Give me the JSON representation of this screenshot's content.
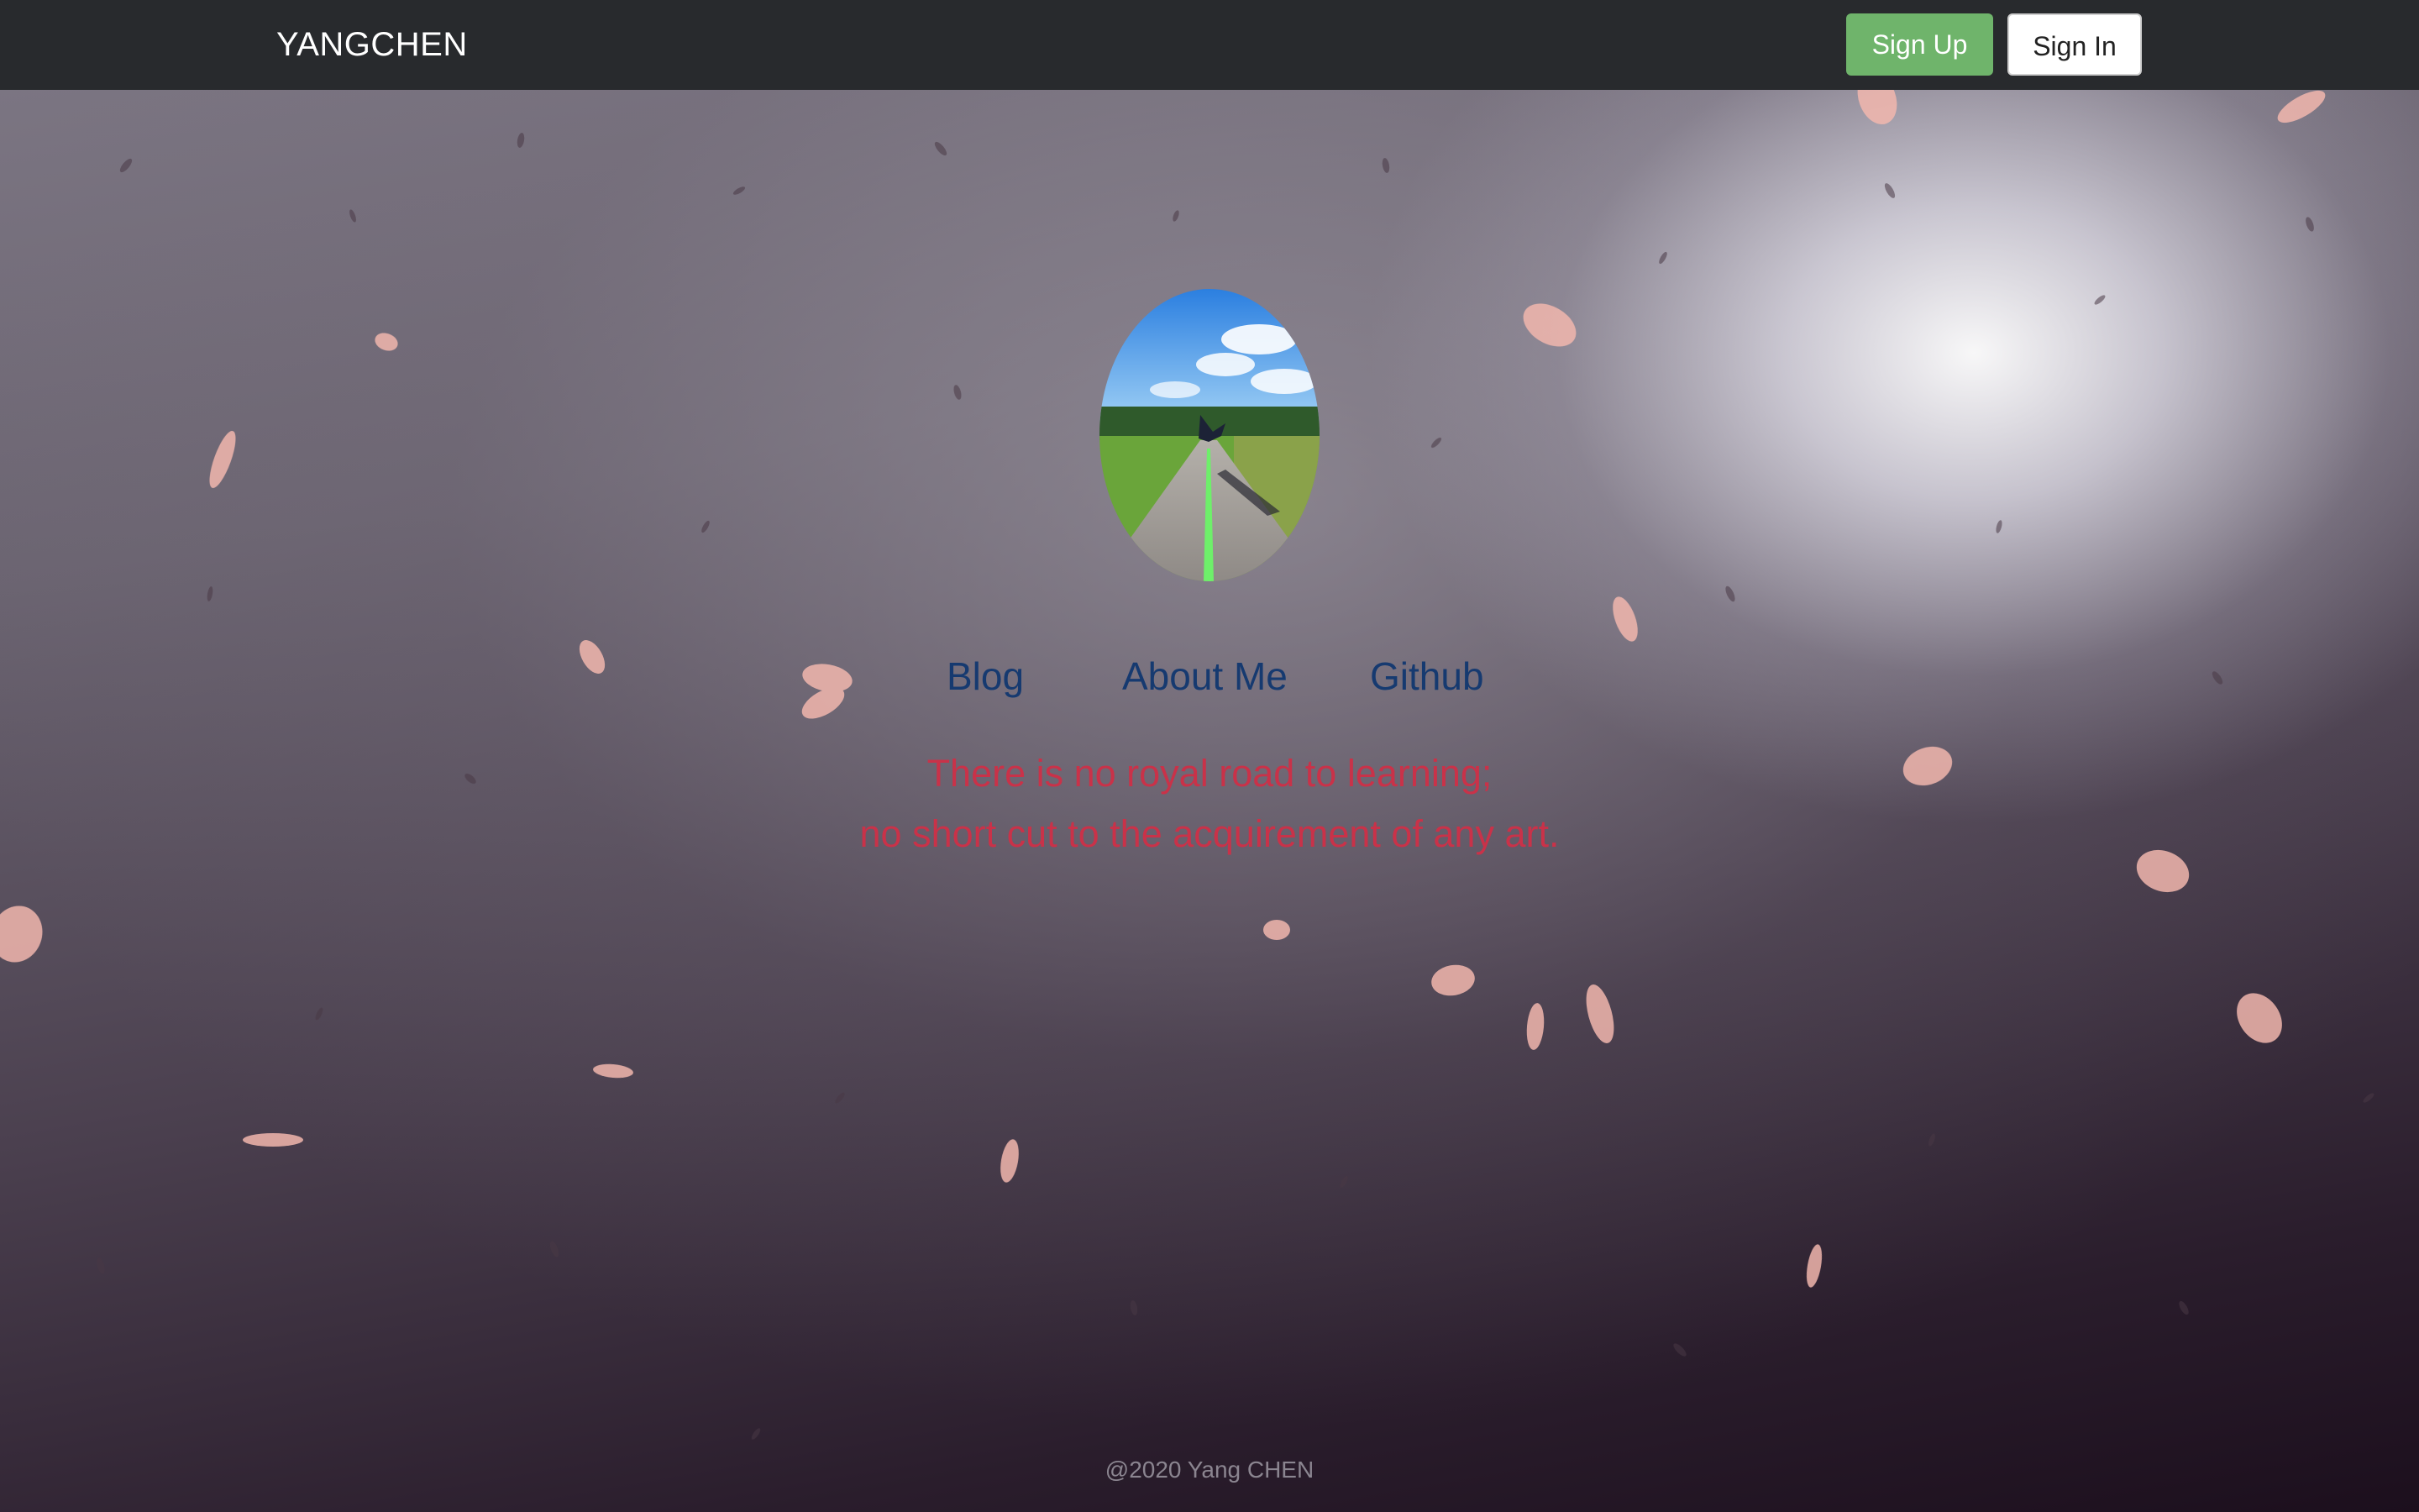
{
  "navbar": {
    "brand": "YANGCHEN",
    "signup_label": "Sign Up",
    "signin_label": "Sign In"
  },
  "profile": {
    "avatar_icon": "profile-photo"
  },
  "links": [
    {
      "label": "Blog"
    },
    {
      "label": "About Me"
    },
    {
      "label": "Github"
    }
  ],
  "quote": {
    "line1": "There is no royal road to learning;",
    "line2": "no short cut to the acquirement of any art."
  },
  "footer": {
    "text": "@2020 Yang CHEN"
  },
  "colors": {
    "navbar_bg": "#282a2d",
    "signup_bg": "#6fb46b",
    "link": "#163a70",
    "quote": "#c93249"
  }
}
